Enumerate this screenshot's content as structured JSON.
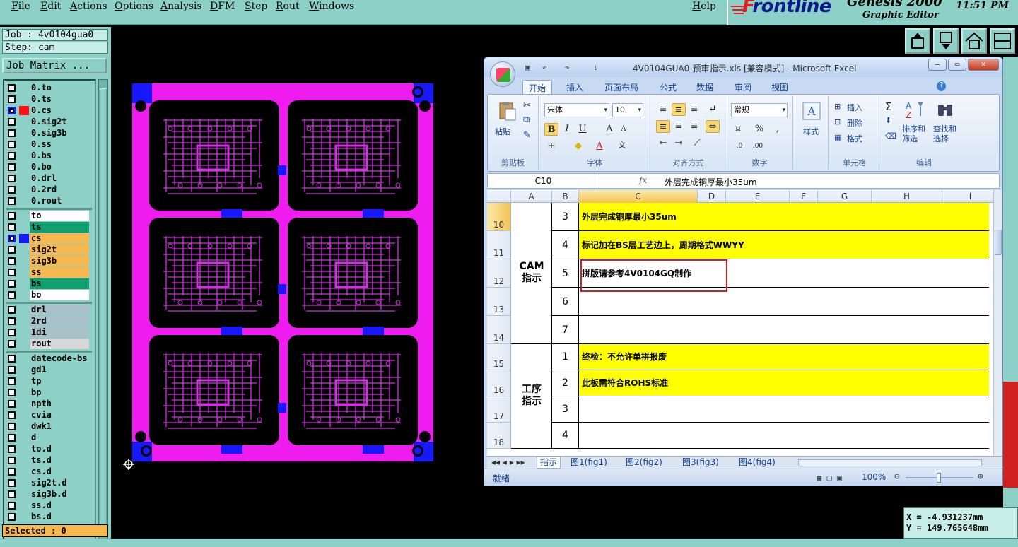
{
  "menubar": {
    "items": [
      "File",
      "Edit",
      "Actions",
      "Options",
      "Analysis",
      "DFM",
      "Step",
      "Rout",
      "Windows"
    ],
    "help": "Help"
  },
  "brand": {
    "logo": "Frontline",
    "product": "Genesis 2000",
    "subtitle": "Graphic Editor",
    "time": "11:51  PM"
  },
  "left_panel": {
    "job": "Job : 4v0104gua0",
    "step": "Step: cam",
    "job_matrix_label": "Job Matrix ...",
    "selected": "Selected : 0",
    "layers": [
      {
        "name": "0.to",
        "color": "#8cd0c8",
        "active": false
      },
      {
        "name": "0.ts",
        "color": "#8cd0c8",
        "active": false
      },
      {
        "name": "0.cs",
        "color": "#ff1010",
        "active": true
      },
      {
        "name": "0.sig2t",
        "color": "#8cd0c8",
        "active": false
      },
      {
        "name": "0.sig3b",
        "color": "#8cd0c8",
        "active": false
      },
      {
        "name": "0.ss",
        "color": "#8cd0c8",
        "active": false
      },
      {
        "name": "0.bs",
        "color": "#8cd0c8",
        "active": false
      },
      {
        "name": "0.bo",
        "color": "#8cd0c8",
        "active": false
      },
      {
        "name": "0.drl",
        "color": "#8cd0c8",
        "active": false
      },
      {
        "name": "0.2rd",
        "color": "#8cd0c8",
        "active": false
      },
      {
        "name": "0.rout",
        "color": "#8cd0c8",
        "active": false
      }
    ],
    "board_layers": [
      {
        "name": "to",
        "bg": "#ffffff",
        "color": "#8cd0c8",
        "active": false
      },
      {
        "name": "ts",
        "bg": "#10a070",
        "color": "#8cd0c8",
        "active": false
      },
      {
        "name": "cs",
        "bg": "#f8b850",
        "color": "#1818ff",
        "active": true
      },
      {
        "name": "sig2t",
        "bg": "#f8b850",
        "color": "#8cd0c8",
        "active": false
      },
      {
        "name": "sig3b",
        "bg": "#f8b850",
        "color": "#8cd0c8",
        "active": false
      },
      {
        "name": "ss",
        "bg": "#f8b850",
        "color": "#8cd0c8",
        "active": false
      },
      {
        "name": "bs",
        "bg": "#10a070",
        "color": "#8cd0c8",
        "active": false
      },
      {
        "name": "bo",
        "bg": "#ffffff",
        "color": "#8cd0c8",
        "active": false
      }
    ],
    "drill_layers": [
      {
        "name": "drl",
        "bg": "#a8c0c8"
      },
      {
        "name": "2rd",
        "bg": "#a8c0c8"
      },
      {
        "name": "1di",
        "bg": "#a8c0c8"
      },
      {
        "name": "rout",
        "bg": "#d8d8d8"
      }
    ],
    "misc_layers": [
      "datecode-bs",
      "gd1",
      "tp",
      "bp",
      "npth",
      "cvia",
      "dwk1",
      "d",
      "to.d",
      "ts.d",
      "cs.d",
      "sig2t.d",
      "sig3b.d",
      "ss.d",
      "bs.d"
    ]
  },
  "excel": {
    "title": "4V0104GUA0-预审指示.xls  [兼容模式] - Microsoft Excel",
    "tabs": [
      "开始",
      "插入",
      "页面布局",
      "公式",
      "数据",
      "审阅",
      "视图"
    ],
    "ribbon": {
      "paste": "粘贴",
      "clipboard": "剪贴板",
      "font_name": "宋体",
      "font_size": "10",
      "font_group": "字体",
      "align_group": "对齐方式",
      "number_format": "常规",
      "number_group": "数字",
      "style": "样式",
      "insert": "插入",
      "delete": "删除",
      "format": "格式",
      "cells_group": "单元格",
      "sort_filter": "排序和\n筛选",
      "find_select": "查找和\n选择",
      "edit_group": "编辑"
    },
    "name_box": "C10",
    "fx": "fx",
    "formula": "外层完成铜厚最小35um",
    "columns": [
      "A",
      "B",
      "C",
      "D",
      "E",
      "F",
      "G",
      "H",
      "I"
    ],
    "sections": [
      {
        "label": "CAM\n指示"
      },
      {
        "label": "工序\n指示"
      }
    ],
    "rows": [
      {
        "row": "10",
        "num": "3",
        "text": "外层完成铜厚最小35um",
        "yellow": true
      },
      {
        "row": "11",
        "num": "4",
        "text": "标记加在BS层工艺边上，周期格式WWYY",
        "yellow": true
      },
      {
        "row": "12",
        "num": "5",
        "text": "拼版请参考4V0104GQ制作",
        "yellow": false
      },
      {
        "row": "13",
        "num": "6",
        "text": "",
        "yellow": false
      },
      {
        "row": "14",
        "num": "7",
        "text": "",
        "yellow": false
      },
      {
        "row": "15",
        "num": "1",
        "text": "终检：不允许单拼报废",
        "yellow": true
      },
      {
        "row": "16",
        "num": "2",
        "text": "此板需符合ROHS标准",
        "yellow": true
      },
      {
        "row": "17",
        "num": "3",
        "text": "",
        "yellow": false
      },
      {
        "row": "18",
        "num": "4",
        "text": "",
        "yellow": false
      }
    ],
    "sheet_tabs": [
      "指示",
      "图1(fig1)",
      "图2(fig2)",
      "图3(fig3)",
      "图4(fig4)"
    ],
    "status": "就绪",
    "zoom": "100%"
  },
  "coords": {
    "x": "X = -4.931237mm",
    "y": "Y = 149.765648mm"
  }
}
